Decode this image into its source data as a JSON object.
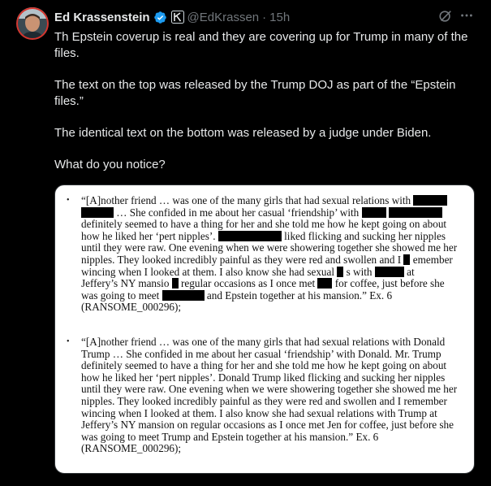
{
  "author": {
    "display_name": "Ed Krassenstein",
    "handle": "@EdKrassen",
    "separator": "·",
    "time": "15h"
  },
  "post": {
    "paragraphs": [
      "Th Epstein coverup is real and they are covering up for Trump in many of the files.",
      "The text on the top was released by the Trump DOJ as part of the “Epstein files.”",
      "The identical text on the bottom was released by a judge under Biden.",
      "What do you notice?"
    ]
  },
  "image": {
    "top_excerpt": {
      "bullet": "•",
      "l1a": "“[A]nother friend … was one of the many girls that had sexual relations with",
      "l2a": "…  She confided in me about her casual ‘friendship’ with",
      "l3": "definitely seemed to have a thing for her and she told me how he kept going on about",
      "l4a": "how he liked her ‘pert nipples’.",
      "l4b": "liked flicking and sucking her nipples",
      "l5": "until they were raw. One evening when we were showering together she showed me her",
      "l6a": "nipples. They looked incredibly painful as they were red and swollen and I",
      "l6b": "emember",
      "l7a": "wincing when I looked at them. I also know she had sexual",
      "l7b": "s with",
      "l7c": "at",
      "l8a": "Jeffery’s NY mansio",
      "l8b": "regular occasions as I once met",
      "l8c": "for coffee, just before she",
      "l9a": "was going to meet",
      "l9b": "and Epstein together at his mansion.” Ex. 6",
      "l10": "(RANSOME_000296);"
    },
    "bottom_excerpt": {
      "bullet": "•",
      "lines": [
        "“[A]nother friend … was one of the many girls that had sexual relations with Donald",
        "Trump …  She confided in me about her casual ‘friendship’ with Donald.  Mr. Trump",
        "definitely seemed to have a thing for her and she told me how he kept going on about",
        "how he liked her ‘pert nipples’. Donald Trump liked flicking and sucking her nipples",
        "until they were raw. One evening when we were showering together she showed me her",
        "nipples. They looked incredibly painful as they were red and swollen and I remember",
        "wincing when I looked at them. I also know she had sexual relations with Trump at",
        "Jeffery’s NY mansion on regular occasions as I once met Jen for coffee, just before she",
        "was going to meet Trump and Epstein together at his mansion.” Ex. 6",
        "(RANSOME_000296);"
      ]
    }
  },
  "icons": {
    "verified": "verified-badge-icon",
    "affiliate": "affiliate-badge-icon",
    "grok": "grok-icon",
    "more": "more-icon"
  },
  "colors": {
    "background": "#000000",
    "text": "#e7e9ea",
    "secondary": "#71767b",
    "verified": "#1d9bf0"
  }
}
